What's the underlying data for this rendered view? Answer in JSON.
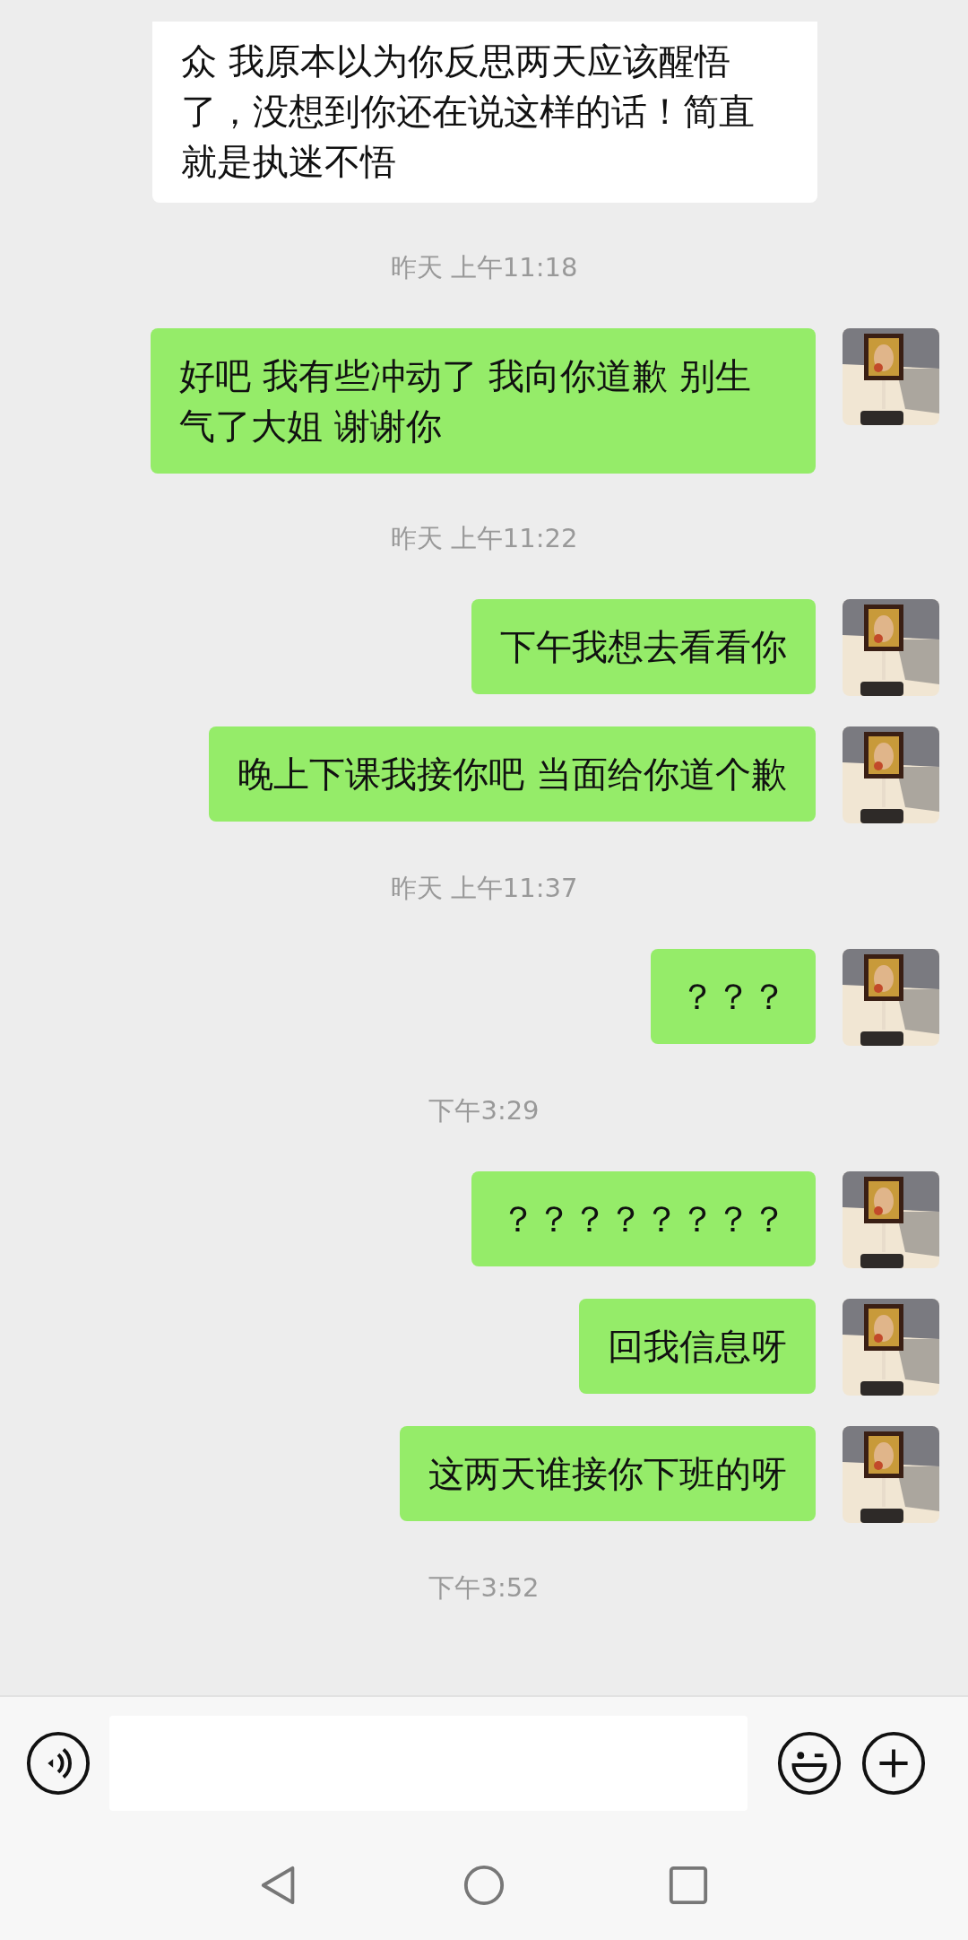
{
  "messages": [
    {
      "kind": "message",
      "sent": false,
      "text": "众 我原本以为你反思两天应该醒悟了，没想到你还在说这样的话！简直就是执迷不悟"
    },
    {
      "kind": "time",
      "text": "昨天 上午11:18"
    },
    {
      "kind": "message",
      "sent": true,
      "text": "好吧 我有些冲动了 我向你道歉 别生气了大姐 谢谢你"
    },
    {
      "kind": "time",
      "text": "昨天 上午11:22"
    },
    {
      "kind": "message",
      "sent": true,
      "text": "下午我想去看看你"
    },
    {
      "kind": "message",
      "sent": true,
      "text": "晚上下课我接你吧 当面给你道个歉"
    },
    {
      "kind": "time",
      "text": "昨天 上午11:37"
    },
    {
      "kind": "message",
      "sent": true,
      "text": "？？？"
    },
    {
      "kind": "time",
      "text": "下午3:29"
    },
    {
      "kind": "message",
      "sent": true,
      "text": "？？？？？？？？"
    },
    {
      "kind": "message",
      "sent": true,
      "text": "回我信息呀"
    },
    {
      "kind": "message",
      "sent": true,
      "text": "这两天谁接你下班的呀"
    },
    {
      "kind": "time",
      "text": "下午3:52"
    }
  ]
}
